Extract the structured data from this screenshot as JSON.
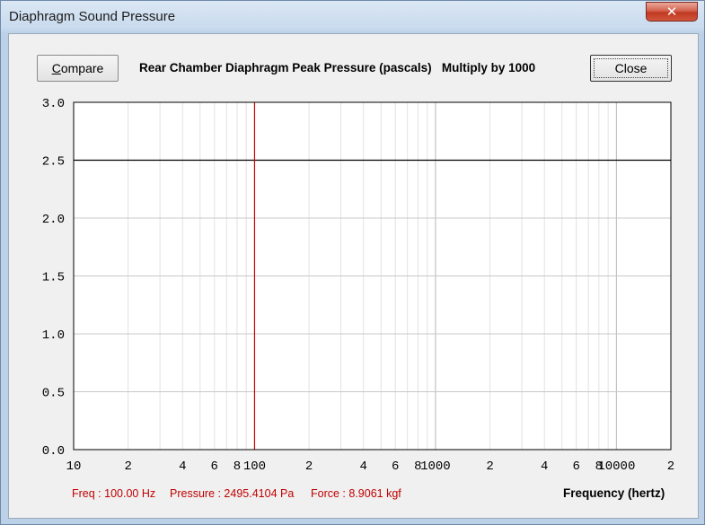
{
  "window": {
    "title": "Diaphragm Sound Pressure",
    "close_glyph": "✕"
  },
  "toolbar": {
    "compare_label_underlined": "C",
    "compare_label_rest": "ompare",
    "close_label": "Close"
  },
  "chart_data": {
    "type": "line",
    "title": "Rear Chamber Diaphragm Peak Pressure (pascals)   Multiply by 1000",
    "xlabel": "Frequency (hertz)",
    "ylabel": "",
    "x_scale": "log",
    "xlim": [
      10,
      20000
    ],
    "ylim": [
      0,
      3.0
    ],
    "y_ticks": [
      "0.0",
      "0.5",
      "1.0",
      "1.5",
      "2.0",
      "2.5",
      "3.0"
    ],
    "x_tick_labels": [
      {
        "value": 10,
        "label": "10"
      },
      {
        "value": 20,
        "label": "2"
      },
      {
        "value": 40,
        "label": "4"
      },
      {
        "value": 60,
        "label": "6"
      },
      {
        "value": 80,
        "label": "8"
      },
      {
        "value": 100,
        "label": "100"
      },
      {
        "value": 200,
        "label": "2"
      },
      {
        "value": 400,
        "label": "4"
      },
      {
        "value": 600,
        "label": "6"
      },
      {
        "value": 800,
        "label": "8"
      },
      {
        "value": 1000,
        "label": "1000"
      },
      {
        "value": 2000,
        "label": "2"
      },
      {
        "value": 4000,
        "label": "4"
      },
      {
        "value": 6000,
        "label": "6"
      },
      {
        "value": 8000,
        "label": "8"
      },
      {
        "value": 10000,
        "label": "10000"
      },
      {
        "value": 20000,
        "label": "2"
      }
    ],
    "series": [
      {
        "x": [
          10,
          20000
        ],
        "y": [
          2.5,
          2.5
        ],
        "color": "#000000"
      }
    ],
    "cursor": {
      "x": 100,
      "color": "#cc0000"
    },
    "grid": true
  },
  "status": {
    "freq": "Freq : 100.00 Hz",
    "pressure": "Pressure : 2495.4104 Pa",
    "force": "Force : 8.9061 kgf"
  }
}
